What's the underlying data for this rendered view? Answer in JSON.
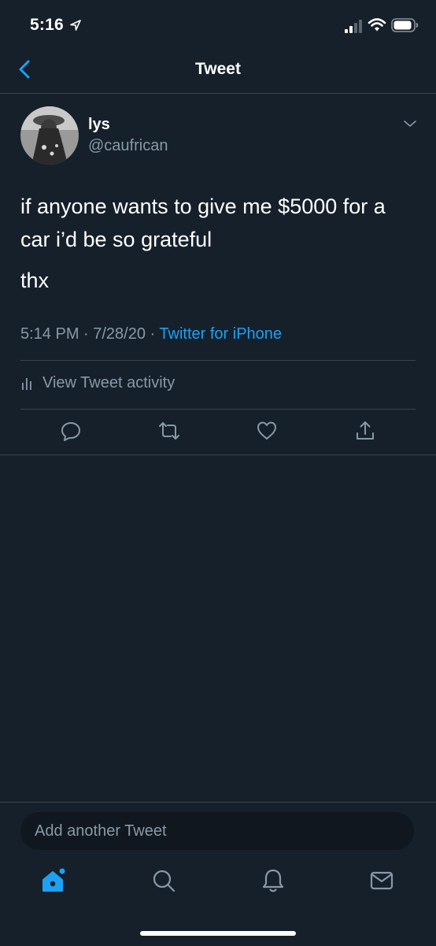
{
  "status": {
    "time": "5:16"
  },
  "nav": {
    "title": "Tweet"
  },
  "tweet": {
    "name": "lys",
    "handle": "@caufrican",
    "text_line1": "if anyone wants to give me $5000 for a car i’d be so grateful",
    "text_line2": "thx",
    "meta_time": "5:14 PM · 7/28/20 · ",
    "meta_source": "Twitter for iPhone",
    "activity_label": "View Tweet activity"
  },
  "composer": {
    "placeholder": "Add another Tweet"
  },
  "colors": {
    "background": "#15202b",
    "accent": "#1da1f2",
    "muted": "#8899a6",
    "divider": "#38444d"
  },
  "icons": [
    "location-arrow-icon",
    "signal-icon",
    "wifi-icon",
    "battery-icon",
    "back-chevron-icon",
    "chevron-down-icon",
    "bar-chart-icon",
    "reply-icon",
    "retweet-icon",
    "like-icon",
    "share-icon",
    "home-icon",
    "search-icon",
    "notifications-icon",
    "messages-icon"
  ]
}
